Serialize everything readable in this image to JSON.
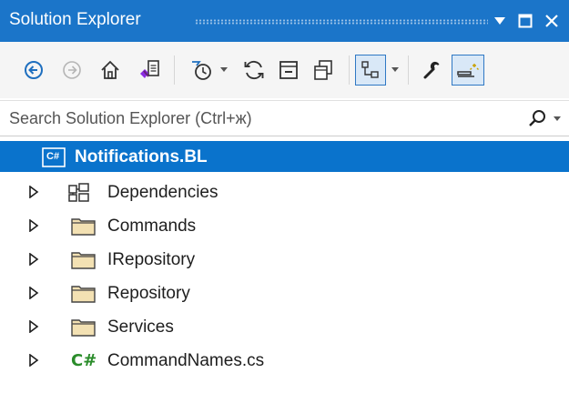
{
  "window": {
    "title": "Solution Explorer",
    "accent_color": "#1b75c9",
    "selection_color": "#0a73cc"
  },
  "search": {
    "placeholder": "Search Solution Explorer (Ctrl+ж)"
  },
  "toolbar": {
    "buttons": [
      {
        "icon": "back-icon"
      },
      {
        "icon": "forward-icon"
      },
      {
        "icon": "home-icon"
      },
      {
        "icon": "switch-views-icon"
      },
      {
        "icon": "pending-changes-filter-icon"
      },
      {
        "icon": "sync-icon"
      },
      {
        "icon": "collapse-all-icon"
      },
      {
        "icon": "show-all-files-icon"
      },
      {
        "icon": "preview-selected-icon"
      },
      {
        "icon": "properties-icon"
      },
      {
        "icon": "preview-icon"
      }
    ]
  },
  "tree": {
    "root": {
      "label": "Notifications.BL",
      "icon": "csharp-project-icon",
      "badge": "C#"
    },
    "items": [
      {
        "label": "Dependencies",
        "icon": "dependencies-icon"
      },
      {
        "label": "Commands",
        "icon": "folder-icon"
      },
      {
        "label": "IRepository",
        "icon": "folder-icon"
      },
      {
        "label": "Repository",
        "icon": "folder-icon"
      },
      {
        "label": "Services",
        "icon": "folder-icon"
      },
      {
        "label": "CommandNames.cs",
        "icon": "csharp-file-icon",
        "badge": "C#"
      }
    ]
  }
}
